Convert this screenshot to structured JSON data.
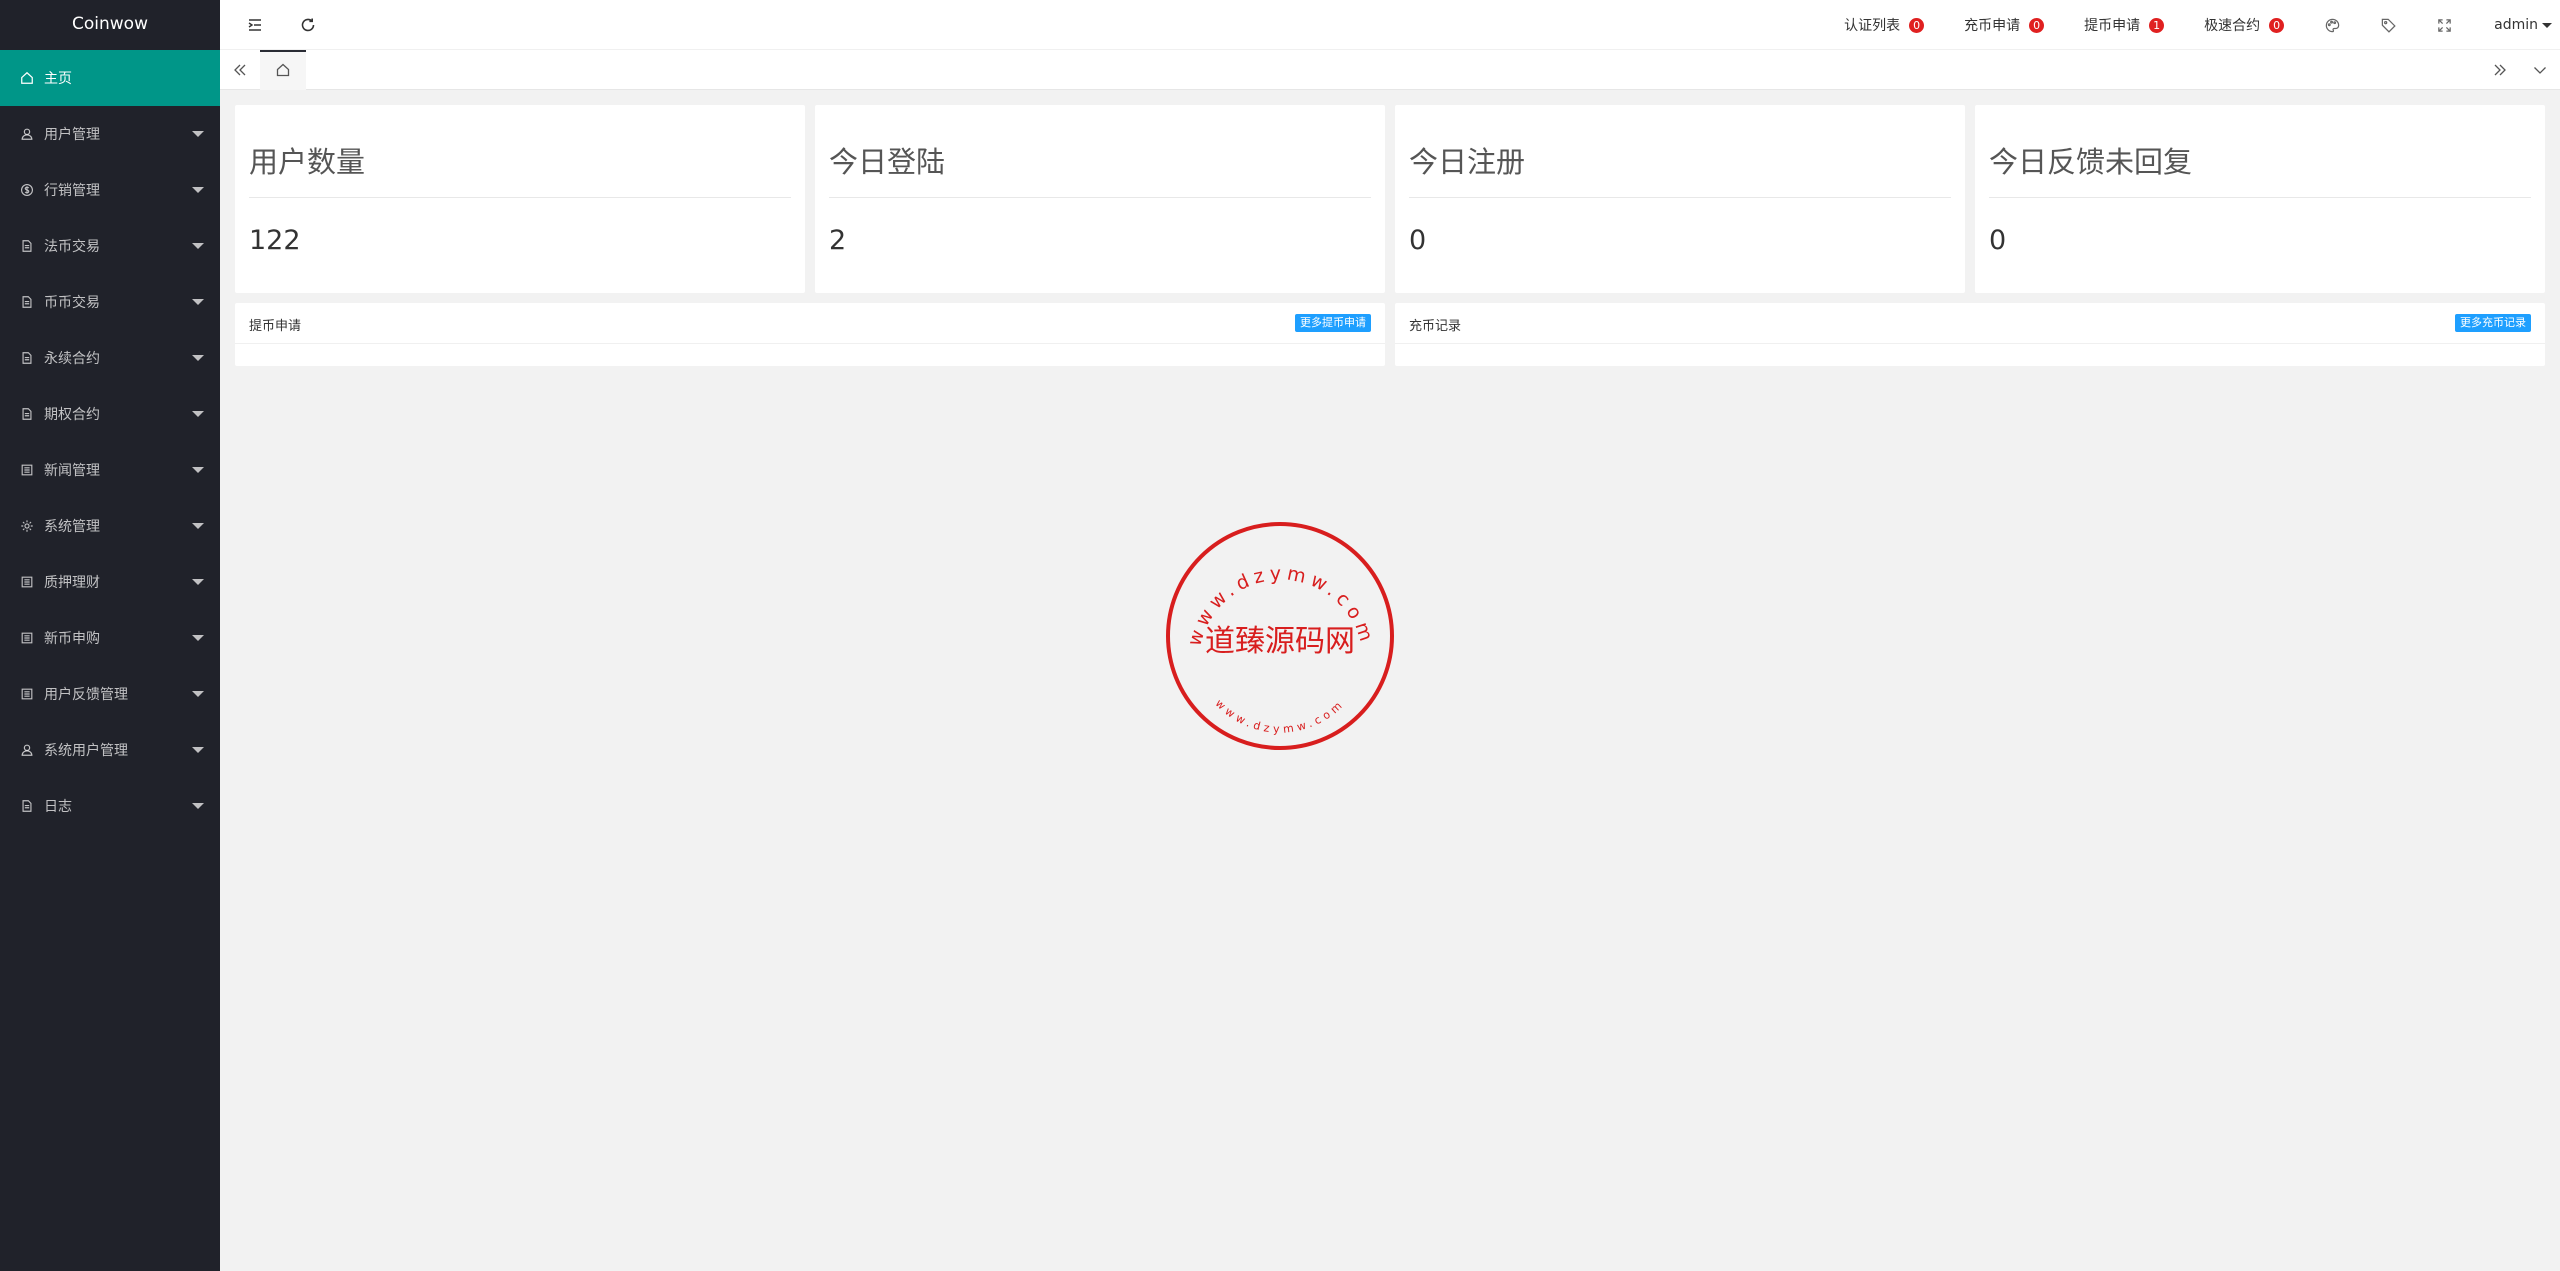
{
  "app": {
    "title": "Coinwow"
  },
  "sidebar": {
    "items": [
      {
        "label": "主页",
        "icon": "home-icon",
        "active": true
      },
      {
        "label": "用户管理",
        "icon": "user-icon"
      },
      {
        "label": "行销管理",
        "icon": "dollar-icon"
      },
      {
        "label": "法币交易",
        "icon": "doc-icon"
      },
      {
        "label": "币币交易",
        "icon": "doc-icon"
      },
      {
        "label": "永续合约",
        "icon": "doc-icon"
      },
      {
        "label": "期权合约",
        "icon": "doc-icon"
      },
      {
        "label": "新闻管理",
        "icon": "list-icon"
      },
      {
        "label": "系统管理",
        "icon": "gear-icon"
      },
      {
        "label": "质押理财",
        "icon": "list-icon"
      },
      {
        "label": "新币申购",
        "icon": "list-icon"
      },
      {
        "label": "用户反馈管理",
        "icon": "list-icon"
      },
      {
        "label": "系统用户管理",
        "icon": "user-icon"
      },
      {
        "label": "日志",
        "icon": "doc-icon"
      }
    ]
  },
  "header": {
    "links": [
      {
        "label": "认证列表",
        "badge": "0"
      },
      {
        "label": "充币申请",
        "badge": "0"
      },
      {
        "label": "提币申请",
        "badge": "1"
      },
      {
        "label": "极速合约",
        "badge": "0"
      }
    ],
    "user": "admin"
  },
  "stats": [
    {
      "title": "用户数量",
      "value": "122"
    },
    {
      "title": "今日登陆",
      "value": "2"
    },
    {
      "title": "今日注册",
      "value": "0"
    },
    {
      "title": "今日反馈未回复",
      "value": "0"
    }
  ],
  "panels": {
    "withdraw": {
      "title": "提币申请",
      "button": "更多提币申请"
    },
    "deposit": {
      "title": "充币记录",
      "button": "更多充币记录"
    }
  },
  "stamp": {
    "center": "道臻源码网",
    "ring": "www.dzymw.com"
  },
  "colors": {
    "sidebar_bg": "#20222a",
    "active": "#009688",
    "badge": "#e02020",
    "button": "#1e9fff",
    "stamp": "#d81e1e"
  }
}
